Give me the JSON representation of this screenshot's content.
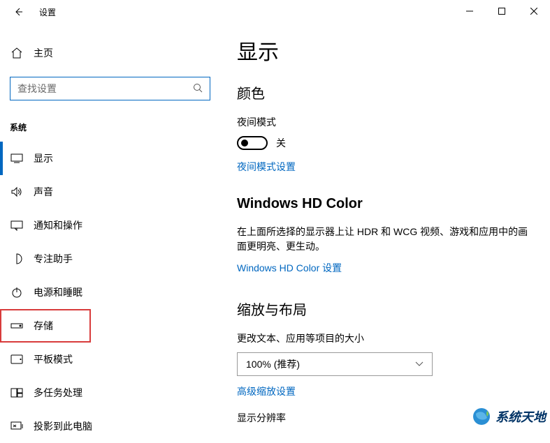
{
  "titlebar": {
    "title": "设置"
  },
  "sidebar": {
    "home": "主页",
    "search_placeholder": "查找设置",
    "category": "系统",
    "items": [
      {
        "icon": "display",
        "label": "显示",
        "selected": true
      },
      {
        "icon": "sound",
        "label": "声音"
      },
      {
        "icon": "notifications",
        "label": "通知和操作"
      },
      {
        "icon": "focus",
        "label": "专注助手"
      },
      {
        "icon": "power",
        "label": "电源和睡眠"
      },
      {
        "icon": "storage",
        "label": "存储",
        "boxed": true
      },
      {
        "icon": "tablet",
        "label": "平板模式"
      },
      {
        "icon": "multitask",
        "label": "多任务处理"
      },
      {
        "icon": "project",
        "label": "投影到此电脑"
      }
    ]
  },
  "content": {
    "page_title": "显示",
    "color": {
      "title": "颜色",
      "night_mode_label": "夜间模式",
      "toggle_state": "关",
      "night_mode_link": "夜间模式设置"
    },
    "hdcolor": {
      "title": "Windows HD Color",
      "desc": "在上面所选择的显示器上让 HDR 和 WCG 视频、游戏和应用中的画面更明亮、更生动。",
      "link": "Windows HD Color 设置"
    },
    "scale": {
      "title": "缩放与布局",
      "text_size_label": "更改文本、应用等项目的大小",
      "dropdown_value": "100% (推荐)",
      "advanced_link": "高级缩放设置",
      "resolution_label": "显示分辨率"
    }
  },
  "watermark": "系统天地"
}
